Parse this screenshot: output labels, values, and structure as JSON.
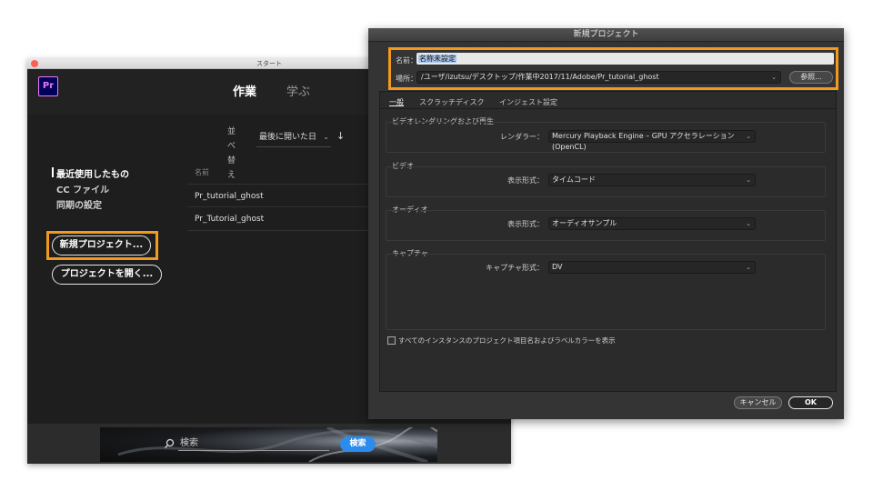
{
  "start_window": {
    "title": "スタート",
    "logo": "Pr",
    "tabs": [
      {
        "label": "作業"
      },
      {
        "label": "学ぶ"
      }
    ],
    "sidebar": {
      "items": [
        {
          "label": "最近使用したもの"
        },
        {
          "label": "CC ファイル"
        },
        {
          "label": "同期の設定"
        }
      ],
      "new_project_label": "新規プロジェクト...",
      "open_project_label": "プロジェクトを開く..."
    },
    "sort": {
      "label": "並べ替え",
      "value": "最後に開いた日"
    },
    "files": {
      "header": "名前",
      "rows": [
        "Pr_tutorial_ghost",
        "Pr_Tutorial_ghost"
      ]
    },
    "search": {
      "placeholder": "検索",
      "button_label": "検索"
    }
  },
  "new_project_dialog": {
    "title": "新規プロジェクト",
    "name_label": "名前：",
    "name_value": "名称未設定",
    "location_label": "場所：",
    "location_value": "/ユーザ/izutsu/デスクトップ/作業中2017/11/Adobe/Pr_tutorial_ghost",
    "browse_label": "参照...",
    "tabs": [
      {
        "label": "一般"
      },
      {
        "label": "スクラッチディスク"
      },
      {
        "label": "インジェスト設定"
      }
    ],
    "sections": [
      {
        "title": "ビデオレンダリングおよび再生",
        "field_label": "レンダラー：",
        "field_value": "Mercury Playback Engine – GPU アクセラレーション (OpenCL)"
      },
      {
        "title": "ビデオ",
        "field_label": "表示形式：",
        "field_value": "タイムコード"
      },
      {
        "title": "オーディオ",
        "field_label": "表示形式：",
        "field_value": "オーディオサンプル"
      },
      {
        "title": "キャプチャ",
        "field_label": "キャプチャ形式：",
        "field_value": "DV"
      }
    ],
    "checkbox_label": "すべてのインスタンスのプロジェクト項目名およびラベルカラーを表示",
    "checkbox_checked": false,
    "cancel_label": "キャンセル",
    "ok_label": "OK"
  },
  "colors": {
    "highlight": "#f39a1e",
    "search_button": "#2d8ceb",
    "premiere_purple": "#ea77ff"
  }
}
